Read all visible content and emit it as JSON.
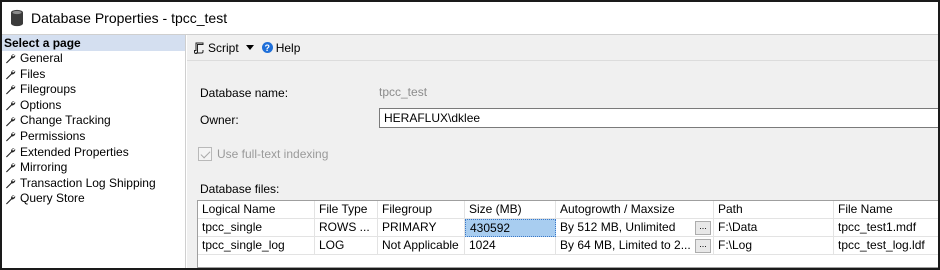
{
  "window": {
    "title": "Database Properties - tpcc_test",
    "icon": "database-icon"
  },
  "sidebar": {
    "header": "Select a page",
    "items": [
      {
        "label": "General"
      },
      {
        "label": "Files"
      },
      {
        "label": "Filegroups"
      },
      {
        "label": "Options"
      },
      {
        "label": "Change Tracking"
      },
      {
        "label": "Permissions"
      },
      {
        "label": "Extended Properties"
      },
      {
        "label": "Mirroring"
      },
      {
        "label": "Transaction Log Shipping"
      },
      {
        "label": "Query Store"
      }
    ]
  },
  "toolbar": {
    "script_label": "Script",
    "help_label": "Help"
  },
  "form": {
    "database_name_label": "Database name:",
    "database_name_value": "tpcc_test",
    "owner_label": "Owner:",
    "owner_value": "HERAFLUX\\dklee",
    "fulltext_label": "Use full-text indexing",
    "fulltext_checked": true,
    "database_files_label": "Database files:"
  },
  "files_grid": {
    "columns": [
      "Logical Name",
      "File Type",
      "Filegroup",
      "Size (MB)",
      "Autogrowth / Maxsize",
      "Path",
      "File Name"
    ],
    "rows": [
      {
        "logical_name": "tpcc_single",
        "file_type": "ROWS ...",
        "filegroup": "PRIMARY",
        "size": "430592",
        "autogrowth": "By 512 MB, Unlimited",
        "path": "F:\\Data",
        "file_name": "tpcc_test1.mdf"
      },
      {
        "logical_name": "tpcc_single_log",
        "file_type": "LOG",
        "filegroup": "Not Applicable",
        "size": "1024",
        "autogrowth": "By 64 MB, Limited to 2...",
        "path": "F:\\Log",
        "file_name": "tpcc_test_log.ldf"
      }
    ],
    "ellipsis_label": "..."
  },
  "colors": {
    "sidebar_header_bg": "#d4dff0",
    "selected_cell_bg": "#a8cdf0",
    "main_bg": "#f0f0f0"
  }
}
